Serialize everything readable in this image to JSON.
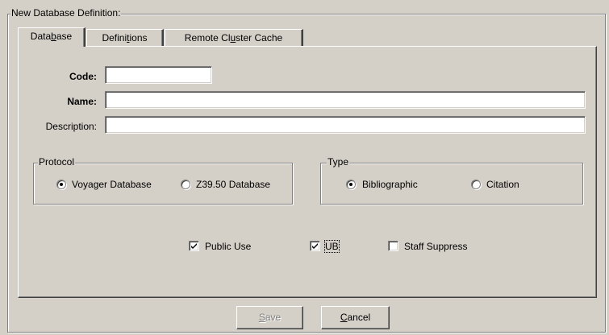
{
  "definition_group": {
    "title": "New Database Definition:"
  },
  "tabs": [
    {
      "pre": "Data",
      "acc": "b",
      "post": "ase",
      "active": true
    },
    {
      "pre": "Defini",
      "acc": "t",
      "post": "ions",
      "active": false
    },
    {
      "pre": "Remote Cl",
      "acc": "u",
      "post": "ster Cache",
      "active": false
    }
  ],
  "form": {
    "code_label": "Code:",
    "code_value": "",
    "name_label": "Name:",
    "name_value": "",
    "description_label": "Description:",
    "description_value": ""
  },
  "protocol": {
    "title": "Protocol",
    "options": [
      {
        "label": "Voyager Database",
        "selected": true
      },
      {
        "label": "Z39.50 Database",
        "selected": false
      }
    ]
  },
  "type": {
    "title": "Type",
    "options": [
      {
        "label": "Bibliographic",
        "selected": true
      },
      {
        "label": "Citation",
        "selected": false
      }
    ]
  },
  "flags": {
    "public_use": {
      "label": "Public Use",
      "checked": true
    },
    "ub": {
      "label": "UB",
      "checked": true
    },
    "staff_suppress": {
      "label": "Staff Suppress",
      "checked": false
    }
  },
  "buttons": {
    "save": {
      "pre": "",
      "acc": "S",
      "post": "ave",
      "disabled": true
    },
    "cancel": {
      "pre": "",
      "acc": "C",
      "post": "ancel",
      "disabled": false
    }
  }
}
